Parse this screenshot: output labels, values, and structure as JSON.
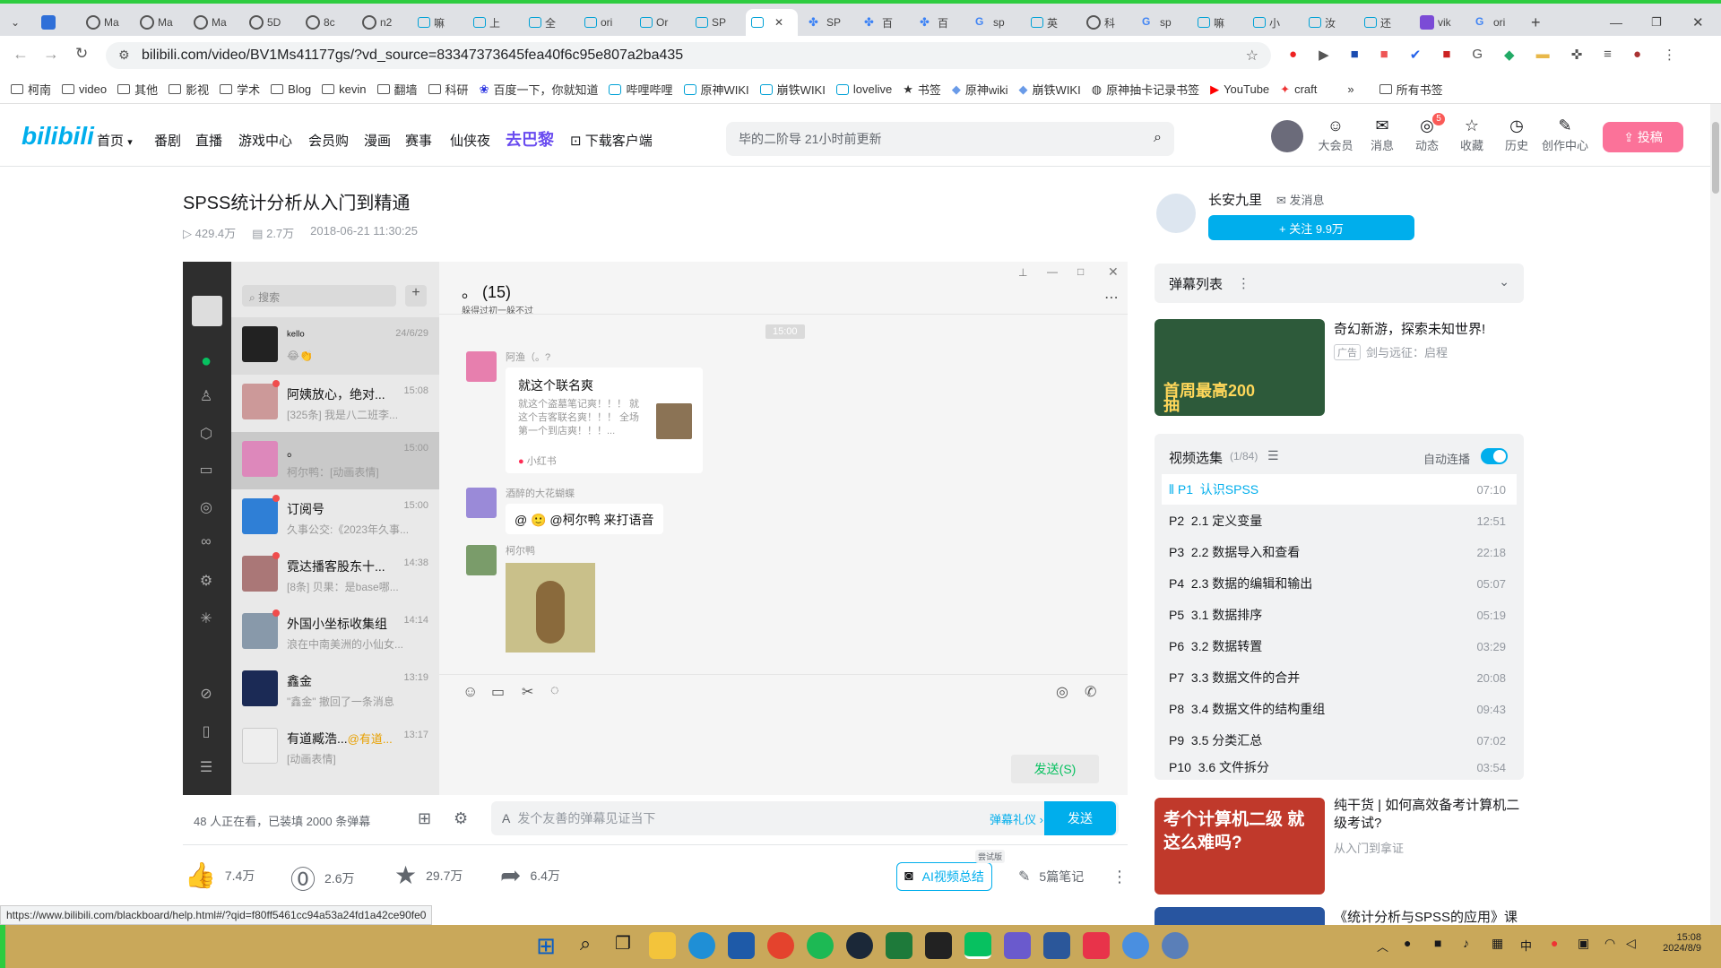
{
  "browser": {
    "tabs": [
      "Ma",
      "Ma",
      "Ma",
      "5D",
      "8c",
      "n2",
      "嘛",
      "上",
      "全",
      "ori",
      "Or",
      "SP",
      "",
      "SP",
      "百",
      "百",
      "sp",
      "英",
      "科",
      "sp",
      "嘛",
      "小",
      "汝",
      "还",
      "vik",
      "ori"
    ],
    "url": "bilibili.com/video/BV1Ms41177gs/?vd_source=83347373645fea40f6c95e807a2ba435",
    "bookmarks": [
      "柯南",
      "video",
      "其他",
      "影视",
      "学术",
      "Blog",
      "kevin",
      "翻墙",
      "科研",
      "百度一下，你就知道",
      "哔哩哔哩",
      "原神WIKI",
      "崩铁WIKI",
      "lovelive",
      "书签",
      "原神wiki",
      "崩铁WIKI",
      "原神抽卡记录书签",
      "YouTube",
      "craft"
    ],
    "all_bookmarks": "所有书签",
    "status_url": "https://www.bilibili.com/blackboard/help.html#/?qid=f80ff5461cc94a53a24fd1a42ce90fe0"
  },
  "header": {
    "logo": "bilibili",
    "nav": [
      "首页",
      "番剧",
      "直播",
      "游戏中心",
      "会员购",
      "漫画",
      "赛事",
      "仙侠夜",
      "去巴黎",
      "下载客户端"
    ],
    "search_placeholder": "毕的二阶导 21小时前更新",
    "icons": [
      {
        "label": "大会员",
        "glyph": "☺"
      },
      {
        "label": "消息",
        "glyph": "✉"
      },
      {
        "label": "动态",
        "glyph": "◎",
        "badge": "5"
      },
      {
        "label": "收藏",
        "glyph": "☆"
      },
      {
        "label": "历史",
        "glyph": "◷"
      },
      {
        "label": "创作中心",
        "glyph": "✎"
      }
    ],
    "upload": "投稿"
  },
  "video": {
    "title": "SPSS统计分析从入门到精通",
    "views": "429.4万",
    "danmaku_count": "2.7万",
    "date": "2018-06-21 11:30:25"
  },
  "wechat": {
    "search": "搜索",
    "chat_title": "。 (15)",
    "chat_subtitle": "躲得过初一躲不过",
    "time_divider": "15:00",
    "contacts": [
      {
        "name": "ᵏᵉˡˡᵒ",
        "time": "24/6/29",
        "preview": "😂👏"
      },
      {
        "name": "阿姨放心，绝对...",
        "time": "15:08",
        "preview": "[325条] 我是八二班李..."
      },
      {
        "name": "。",
        "time": "15:00",
        "preview": "柯尔鸭：[动画表情]"
      },
      {
        "name": "订阅号",
        "time": "15:00",
        "preview": "久事公交:《2023年久事..."
      },
      {
        "name": "霓达播客股东十...",
        "time": "14:38",
        "preview": "[8条] 贝果：是base哪..."
      },
      {
        "name": "外国小坐标收集组",
        "time": "14:14",
        "preview": "浪在中南美洲的小仙女..."
      },
      {
        "name": "鑫金",
        "time": "13:19",
        "preview": "\"鑫金\" 撤回了一条消息"
      },
      {
        "name": "有道臧浩...",
        "time": "13:17",
        "preview": "[动画表情]"
      }
    ],
    "at_mention": "@有道...",
    "msg1_sender": "阿渔（。?",
    "msg1_title": "就这个联名爽",
    "msg1_body": "就这个盗墓笔记爽！！！ 就这个吉客联名爽！！！ 全场第一个到店爽！！！...",
    "msg1_source": "小红书",
    "msg2_sender": "酒醉的大花蝴蝶",
    "msg2_text": "@ 🙂 @柯尔鸭 来打语音",
    "msg3_sender": "柯尔鸭",
    "send_button": "发送(S)"
  },
  "danmaku_bar": {
    "watching": "48 人正在看，已装填 2000 条弹幕",
    "placeholder": "发个友善的弹幕见证当下",
    "etiquette": "弹幕礼仪 ›",
    "send": "发送"
  },
  "actions": {
    "like": "7.4万",
    "coin": "2.6万",
    "fav": "29.7万",
    "share": "6.4万",
    "ai_summary": "AI视频总结",
    "ai_badge": "尝试版",
    "notes": "5篇笔记"
  },
  "uploader": {
    "name": "长安九里",
    "message": "发消息",
    "follow": "+ 关注 9.9万"
  },
  "sidebar": {
    "danmaku_list": "弹幕列表",
    "ad_title": "奇幻新游，探索未知世界!",
    "ad_tag": "广告",
    "ad_sub": "剑与远征：启程",
    "ad_image_text": "首周最高200抽",
    "collection_title": "视频选集",
    "collection_count": "(1/84)",
    "autoplay": "自动连播",
    "episodes": [
      {
        "p": "P1",
        "title": "认识SPSS",
        "dur": "07:10"
      },
      {
        "p": "P2",
        "title": "2.1 定义变量",
        "dur": "12:51"
      },
      {
        "p": "P3",
        "title": "2.2 数据导入和查看",
        "dur": "22:18"
      },
      {
        "p": "P4",
        "title": "2.3 数据的编辑和输出",
        "dur": "05:07"
      },
      {
        "p": "P5",
        "title": "3.1 数据排序",
        "dur": "05:19"
      },
      {
        "p": "P6",
        "title": "3.2 数据转置",
        "dur": "03:29"
      },
      {
        "p": "P7",
        "title": "3.3 数据文件的合并",
        "dur": "20:08"
      },
      {
        "p": "P8",
        "title": "3.4 数据文件的结构重组",
        "dur": "09:43"
      },
      {
        "p": "P9",
        "title": "3.5 分类汇总",
        "dur": "07:02"
      },
      {
        "p": "P10",
        "title": "3.6 文件拆分",
        "dur": "03:54"
      }
    ],
    "rec1_title": "纯干货 | 如何高效备考计算机二级考试?",
    "rec1_sub": "从入门到拿证",
    "rec1_image_text": "考个计算机二级 就这么难吗?",
    "rec2_title": "《统计分析与SPSS的应用》课"
  },
  "taskbar": {
    "time": "15:08",
    "date": "2024/8/9",
    "ime": "中"
  },
  "colors": {
    "brand": "#00aeec",
    "pink": "#fb7299",
    "wechat_green": "#07c160"
  }
}
